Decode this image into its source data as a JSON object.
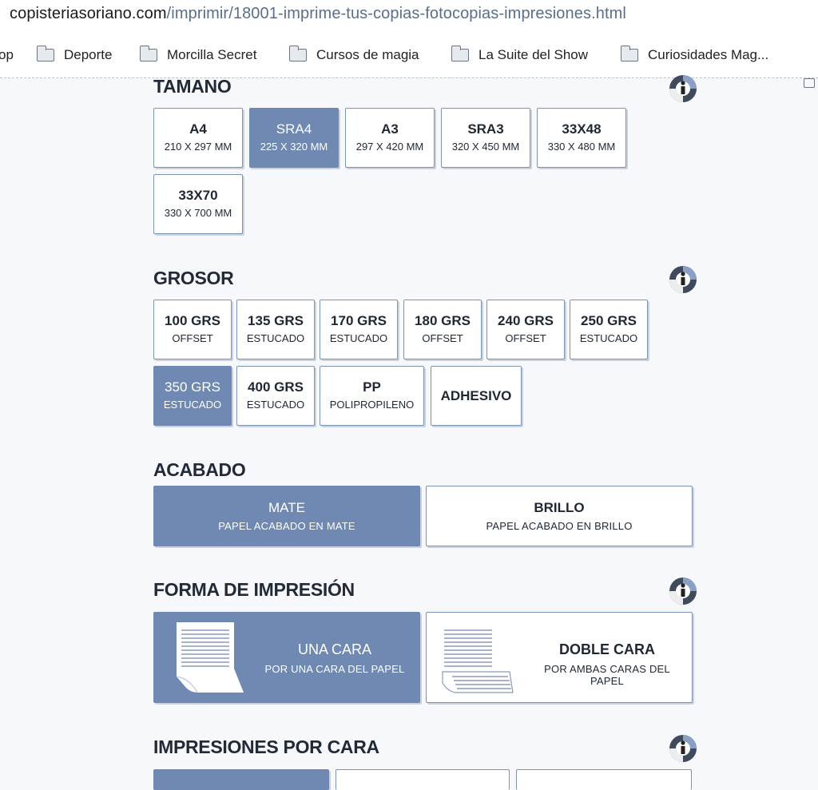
{
  "browser": {
    "url_host": "copisteriasoriano.com",
    "url_path": "/imprimir/18001-imprime-tus-copias-fotocopias-impresiones.html",
    "bookmarks": [
      {
        "label": "op"
      },
      {
        "label": "Deporte"
      },
      {
        "label": "Morcilla Secret"
      },
      {
        "label": "Cursos de magia"
      },
      {
        "label": "La Suite del Show"
      },
      {
        "label": "Curiosidades Mag..."
      }
    ]
  },
  "sections": {
    "tamano": {
      "title": "TAMANO",
      "options": [
        {
          "title": "A4",
          "sub": "210 X 297 MM",
          "selected": false
        },
        {
          "title": "SRA4",
          "sub": "225 X 320 MM",
          "selected": true
        },
        {
          "title": "A3",
          "sub": "297 X 420 MM",
          "selected": false
        },
        {
          "title": "SRA3",
          "sub": "320 X 450 MM",
          "selected": false
        },
        {
          "title": "33X48",
          "sub": "330 X 480 MM",
          "selected": false
        },
        {
          "title": "33X70",
          "sub": "330 X 700 MM",
          "selected": false
        }
      ]
    },
    "grosor": {
      "title": "GROSOR",
      "options": [
        {
          "title": "100 GRS",
          "sub": "OFFSET",
          "selected": false
        },
        {
          "title": "135 GRS",
          "sub": "ESTUCADO",
          "selected": false
        },
        {
          "title": "170 GRS",
          "sub": "ESTUCADO",
          "selected": false
        },
        {
          "title": "180 GRS",
          "sub": "OFFSET",
          "selected": false
        },
        {
          "title": "240 GRS",
          "sub": "OFFSET",
          "selected": false
        },
        {
          "title": "250 GRS",
          "sub": "ESTUCADO",
          "selected": false
        },
        {
          "title": "350 GRS",
          "sub": "ESTUCADO",
          "selected": true
        },
        {
          "title": "400 GRS",
          "sub": "ESTUCADO",
          "selected": false
        },
        {
          "title": "PP",
          "sub": "POLIPROPILENO",
          "selected": false
        },
        {
          "title": "ADHESIVO",
          "sub": "",
          "selected": false
        }
      ]
    },
    "acabado": {
      "title": "ACABADO",
      "options": [
        {
          "title": "MATE",
          "sub": "PAPEL ACABADO EN MATE",
          "selected": true
        },
        {
          "title": "BRILLO",
          "sub": "PAPEL ACABADO EN BRILLO",
          "selected": false
        }
      ]
    },
    "forma": {
      "title": "FORMA DE IMPRESIÓN",
      "options": [
        {
          "title": "UNA CARA",
          "sub": "POR UNA CARA DEL PAPEL",
          "selected": true,
          "icon": "single-sided-page-icon"
        },
        {
          "title": "DOBLE CARA",
          "sub": "POR AMBAS CARAS DEL PAPEL",
          "selected": false,
          "icon": "double-sided-page-icon"
        }
      ]
    },
    "impresiones": {
      "title": "IMPRESIONES POR CARA",
      "options": [
        {
          "selected": true
        },
        {
          "selected": false
        },
        {
          "selected": false
        }
      ]
    }
  },
  "colors": {
    "accent": "#6f89b3",
    "border": "#7d93b3",
    "background": "#f6f8fb"
  }
}
